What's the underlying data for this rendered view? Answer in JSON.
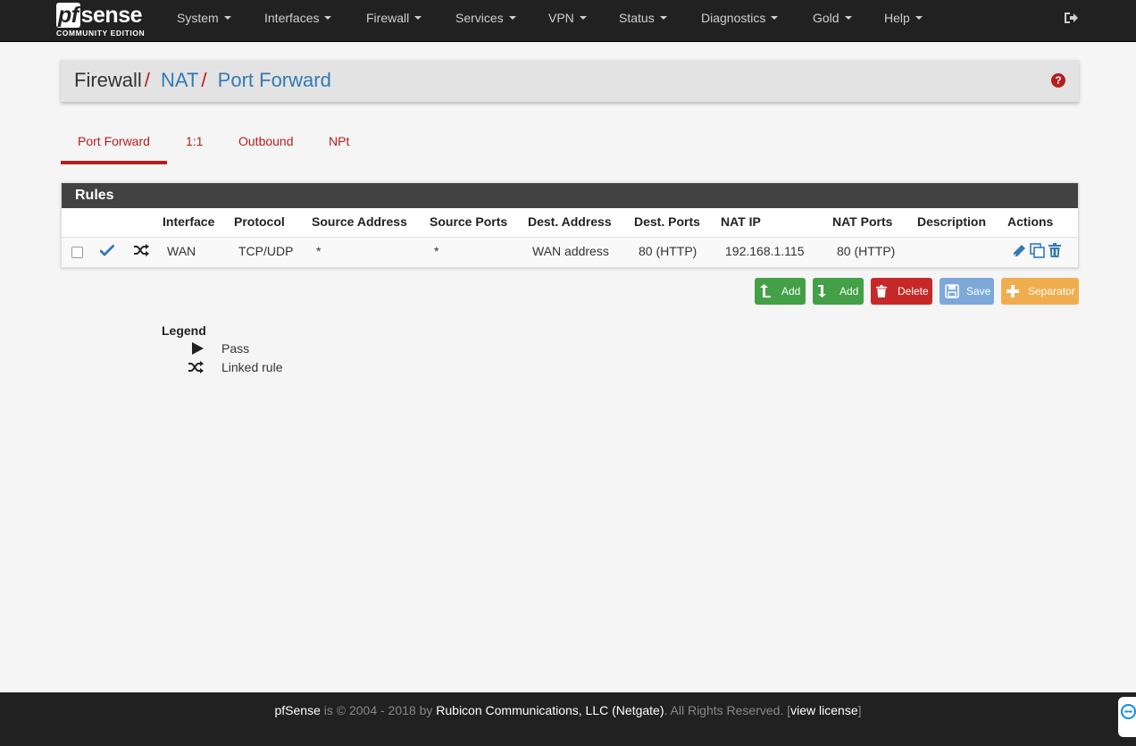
{
  "brand": {
    "logo_text": "pfsense",
    "logo_pf": "pf",
    "logo_sense": "sense",
    "subtitle": "COMMUNITY EDITION"
  },
  "nav": {
    "items": [
      {
        "label": "System"
      },
      {
        "label": "Interfaces"
      },
      {
        "label": "Firewall"
      },
      {
        "label": "Services"
      },
      {
        "label": "VPN"
      },
      {
        "label": "Status"
      },
      {
        "label": "Diagnostics"
      },
      {
        "label": "Gold"
      },
      {
        "label": "Help"
      }
    ],
    "logout_icon": "sign-out-icon"
  },
  "breadcrumb": {
    "part1": "Firewall",
    "sep": "/",
    "part2": "NAT",
    "part3": "Port Forward",
    "help_icon": "question-circle-icon"
  },
  "tabs": [
    {
      "label": "Port Forward",
      "active": true
    },
    {
      "label": "1:1"
    },
    {
      "label": "Outbound"
    },
    {
      "label": "NPt"
    }
  ],
  "rules": {
    "title": "Rules",
    "columns": [
      "Interface",
      "Protocol",
      "Source Address",
      "Source Ports",
      "Dest. Address",
      "Dest. Ports",
      "NAT IP",
      "NAT Ports",
      "Description",
      "Actions"
    ],
    "rows": [
      {
        "status_icon": "check-icon",
        "linked_icon": "random-icon",
        "interface": "WAN",
        "protocol": "TCP/UDP",
        "source_address": "*",
        "source_ports": "*",
        "dest_address": "WAN address",
        "dest_ports": "80 (HTTP)",
        "nat_ip": "192.168.1.115",
        "nat_ports": "80 (HTTP)",
        "description": "",
        "actions": [
          "pencil-icon",
          "clone-icon",
          "trash-icon"
        ]
      }
    ]
  },
  "buttons": {
    "add_top": "Add",
    "add_bottom": "Add",
    "delete": "Delete",
    "save": "Save",
    "separator": "Separator",
    "colors": {
      "add": "#43a047",
      "delete": "#c62828",
      "save": "#7da9d9",
      "separator": "#f0ad4e"
    }
  },
  "legend": {
    "title": "Legend",
    "items": [
      {
        "icon": "play-icon",
        "label": "Pass"
      },
      {
        "icon": "random-icon",
        "label": "Linked rule"
      }
    ]
  },
  "footer": {
    "product": "pfSense",
    "text1": " is © 2004 - 2018 by ",
    "company": "Rubicon Communications, LLC (Netgate)",
    "text2": ". All Rights Reserved. [",
    "license": "view license",
    "text3": "]"
  }
}
